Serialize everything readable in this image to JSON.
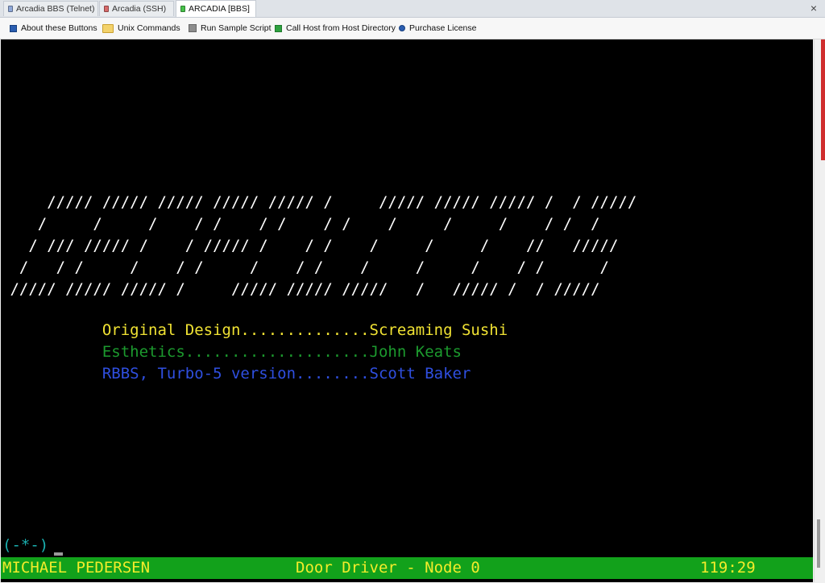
{
  "tabs": [
    {
      "label": "Arcadia BBS (Telnet)",
      "color": "#8fa8d8"
    },
    {
      "label": "Arcadia (SSH)",
      "color": "#d86a6a"
    },
    {
      "label": "ARCADIA [BBS]",
      "color": "#47c24a"
    }
  ],
  "close_label": "×",
  "toolbar": {
    "about": "About these Buttons",
    "unix": "Unix Commands",
    "script": "Run Sample Script",
    "call": "Call Host from Host Directory",
    "license": "Purchase License"
  },
  "terminal": {
    "art": [
      "     ///// ///// ///// ///// ///// /     ///// ///// ///// /  / /////",
      "    /     /     /    / /    / /    / /    /     /     /    / /  /",
      "   / /// ///// /    / ///// /    / /    /     /     /    //   /////",
      "  /   / /     /    / /     /    / /    /     /     /    / /      /",
      " ///// ///// ///// /     ///// ///// /////   /   ///// /  / /////"
    ],
    "credits": [
      {
        "text": "           Original Design..............Screaming Sushi",
        "color": "yellow"
      },
      {
        "text": "           Esthetics....................John Keats",
        "color": "green"
      },
      {
        "text": "           RBBS, Turbo-5 version........Scott Baker",
        "color": "blue"
      }
    ],
    "prompt": "(-*-)",
    "status_user": "MICHAEL PEDERSEN",
    "status_center": "Door Driver - Node 0",
    "status_time": "119:29"
  },
  "colors": {
    "terminal_bg": "#000000",
    "status_bg": "#12a11b",
    "status_fg": "#f3ec2b",
    "yellow": "#f0e233",
    "green": "#1c9a2e",
    "blue": "#2f4fe0",
    "prompt": "#1ab0b0"
  }
}
